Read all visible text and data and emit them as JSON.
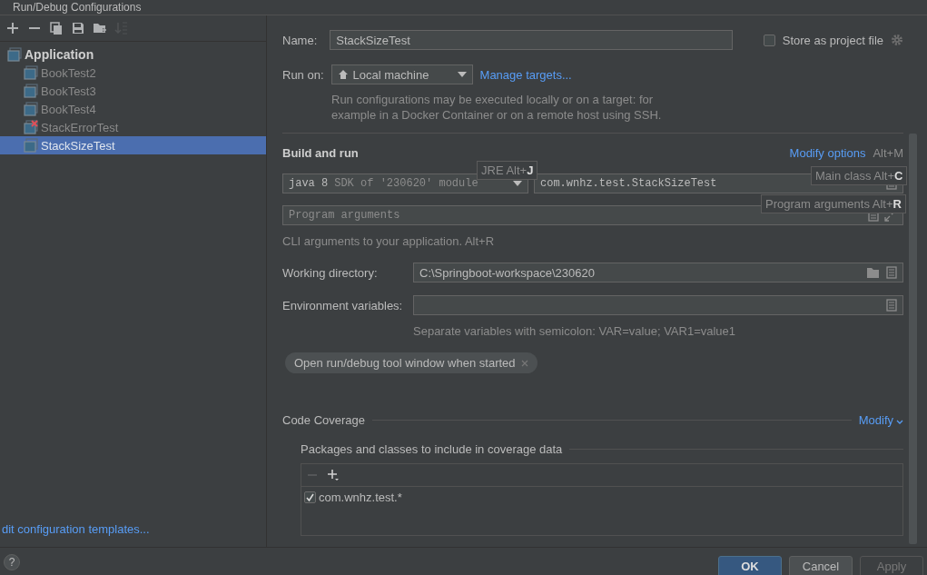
{
  "window": {
    "title": "Run/Debug Configurations"
  },
  "toolbar": [
    {
      "kind": "add",
      "disabled": false
    },
    {
      "kind": "remove",
      "disabled": false
    },
    {
      "kind": "copy",
      "disabled": false
    },
    {
      "kind": "save",
      "disabled": false
    },
    {
      "kind": "folder",
      "disabled": false
    },
    {
      "kind": "sort",
      "disabled": true
    }
  ],
  "tree": [
    {
      "label": "Application",
      "selected": false,
      "children": [
        {
          "label": "BookTest2",
          "selected": false,
          "error": false
        },
        {
          "label": "BookTest3",
          "selected": false,
          "error": false
        },
        {
          "label": "BookTest4",
          "selected": false,
          "error": false
        },
        {
          "label": "StackErrorTest",
          "selected": false,
          "error": true
        },
        {
          "label": "StackSizeTest",
          "selected": true,
          "error": false
        }
      ]
    }
  ],
  "templates_link": "dit configuration templates...",
  "form": {
    "name_label": "Name:",
    "name_value": "StackSizeTest",
    "store": {
      "label": "Store as project file",
      "checked": false
    },
    "run_on_label": "Run on:",
    "run_on_value": "Local machine",
    "manage_targets": "Manage targets...",
    "run_on_hint": "Run configurations may be executed locally or on a target: for example in a Docker Container or on a remote host using SSH.",
    "section": "Build and run",
    "modify_options": "Modify options",
    "modify_shortcut": "Alt+M",
    "jre_version": "java 8",
    "jre_detail": "SDK of '230620' module",
    "main_class": "com.wnhz.test.StackSizeTest",
    "program_args_placeholder": "Program arguments",
    "cli_hint": "CLI arguments to your application. Alt+R",
    "working_dir_label": "Working directory:",
    "working_dir_value": "C:\\Springboot-workspace\\230620",
    "env_label": "Environment variables:",
    "env_hint": "Separate variables with semicolon: VAR=value; VAR1=value1",
    "option_chip": "Open run/debug tool window when started",
    "coverage_title": "Code Coverage",
    "coverage_modify": "Modify",
    "packages_label": "Packages and classes to include in coverage data",
    "packages": [
      {
        "pattern": "com.wnhz.test.*",
        "checked": true
      }
    ]
  },
  "tooltips": [
    {
      "kind": "jre",
      "text": "JRE Alt+**J**"
    },
    {
      "kind": "main",
      "text": "Main class Alt+**C**"
    },
    {
      "kind": "args",
      "text": "Program arguments Alt+**R**"
    }
  ],
  "help": "?",
  "buttons": [
    {
      "label": "OK",
      "kind": "primary",
      "disabled": false
    },
    {
      "label": "Cancel",
      "kind": "normal",
      "disabled": false
    },
    {
      "label": "Apply",
      "kind": "normal",
      "disabled": true
    }
  ]
}
